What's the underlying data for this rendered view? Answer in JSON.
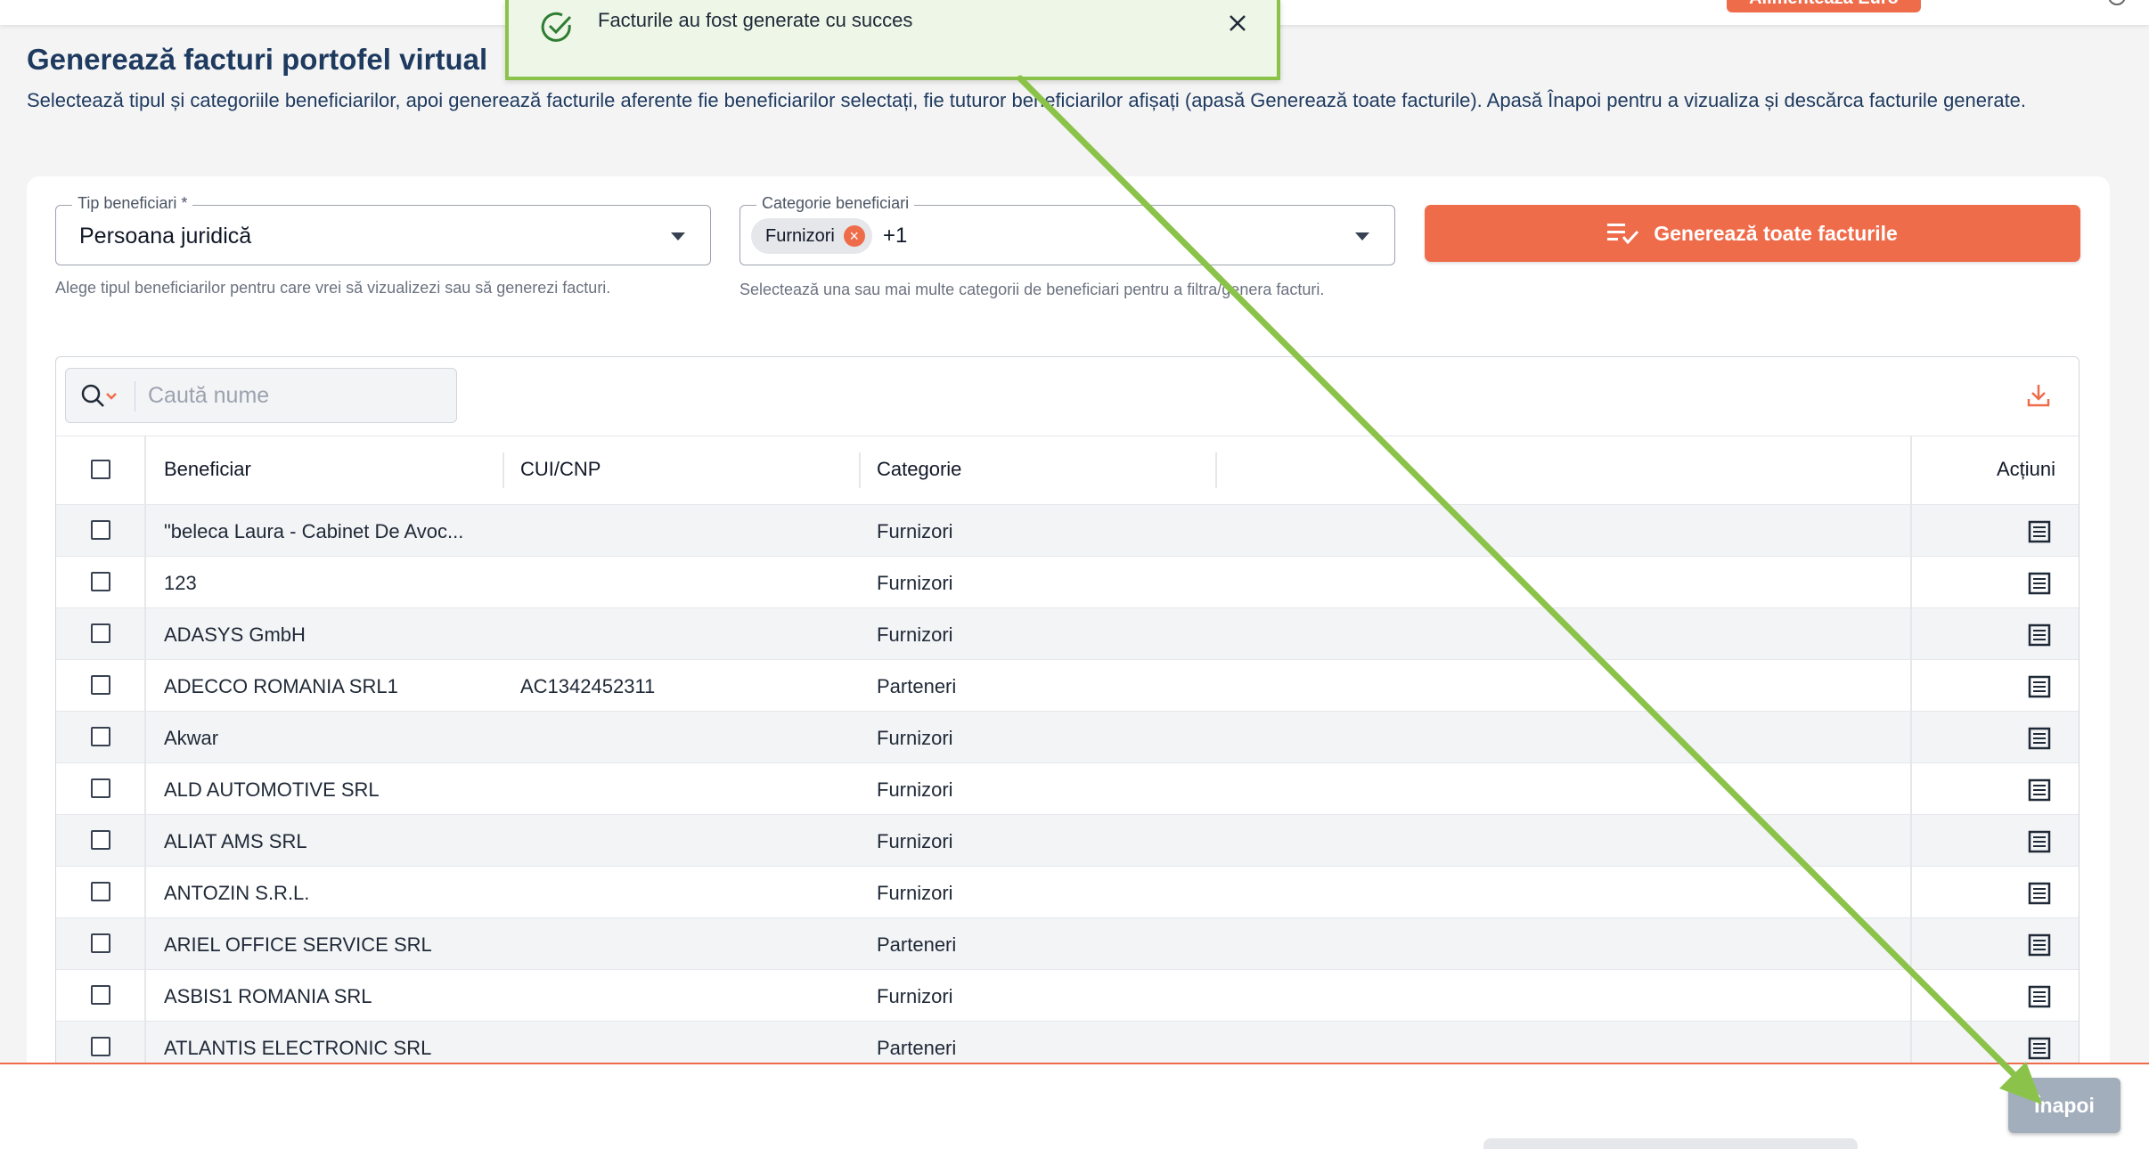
{
  "header": {
    "top_button_label": "Alimentează Euro"
  },
  "page": {
    "title": "Generează facturi portofel virtual",
    "description": "Selectează tipul și categoriile beneficiarilor, apoi generează facturile aferente fie beneficiarilor selectați, fie tuturor beneficiarilor afișați (apasă Generează toate facturile). Apasă Înapoi pentru a vizualiza și descărca facturile generate."
  },
  "filters": {
    "type": {
      "label": "Tip beneficiari *",
      "value": "Persoana juridică",
      "helper": "Alege tipul beneficiarilor pentru care vrei să vizualizezi sau să generezi facturi."
    },
    "category": {
      "label": "Categorie beneficiari",
      "chip": "Furnizori",
      "more": "+1",
      "helper": "Selectează una sau mai multe categorii de beneficiari pentru a filtra/genera facturi."
    },
    "generate_all_label": "Generează toate facturile"
  },
  "search": {
    "placeholder": "Caută nume"
  },
  "table": {
    "columns": {
      "beneficiary": "Beneficiar",
      "cui": "CUI/CNP",
      "category": "Categorie",
      "actions": "Acțiuni"
    },
    "rows": [
      {
        "name": "\"beleca Laura - Cabinet De Avoc...",
        "cui": "",
        "category": "Furnizori"
      },
      {
        "name": "123",
        "cui": "",
        "category": "Furnizori"
      },
      {
        "name": "ADASYS GmbH",
        "cui": "",
        "category": "Furnizori"
      },
      {
        "name": "ADECCO ROMANIA SRL1",
        "cui": "AC1342452311",
        "category": "Parteneri"
      },
      {
        "name": "Akwar",
        "cui": "",
        "category": "Furnizori"
      },
      {
        "name": "ALD AUTOMOTIVE SRL",
        "cui": "",
        "category": "Furnizori"
      },
      {
        "name": "ALIAT AMS SRL",
        "cui": "",
        "category": "Furnizori"
      },
      {
        "name": "ANTOZIN S.R.L.",
        "cui": "",
        "category": "Furnizori"
      },
      {
        "name": "ARIEL OFFICE SERVICE SRL",
        "cui": "",
        "category": "Parteneri"
      },
      {
        "name": "ASBIS1 ROMANIA SRL",
        "cui": "",
        "category": "Furnizori"
      },
      {
        "name": "ATLANTIS ELECTRONIC SRL",
        "cui": "",
        "category": "Parteneri"
      }
    ]
  },
  "footer": {
    "back_label": "Înapoi"
  },
  "toast": {
    "message": "Facturile au fost generate cu succes"
  },
  "colors": {
    "accent": "#ef6c4b",
    "title": "#1e3a5f",
    "toast_border": "#8bc34a",
    "back_button": "#a3aebd"
  }
}
